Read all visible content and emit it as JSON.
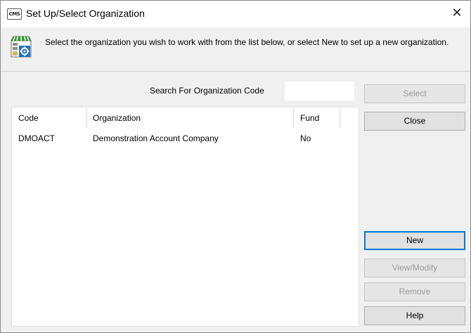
{
  "window": {
    "app_icon_text": "CMS",
    "title": "Set Up/Select Organization",
    "close_glyph": "✕"
  },
  "header": {
    "icon": "store-settings-icon",
    "instruction": "Select the organization you wish to work with from the list below, or select New to set up a new organization."
  },
  "search": {
    "label": "Search For Organization Code",
    "value": ""
  },
  "list": {
    "columns": [
      "Code",
      "Organization",
      "Fund"
    ],
    "rows": [
      [
        "DMOACT",
        "Demonstration Account Company",
        "No"
      ]
    ]
  },
  "buttons": {
    "select": "Select",
    "close": "Close",
    "new": "New",
    "view_modify": "View/Modify",
    "remove": "Remove",
    "help": "Help"
  },
  "colors": {
    "focus_border": "#0078d7",
    "disabled_text": "#9a9a9a",
    "icon_green": "#3a9a3a",
    "icon_blue": "#1e73be"
  }
}
